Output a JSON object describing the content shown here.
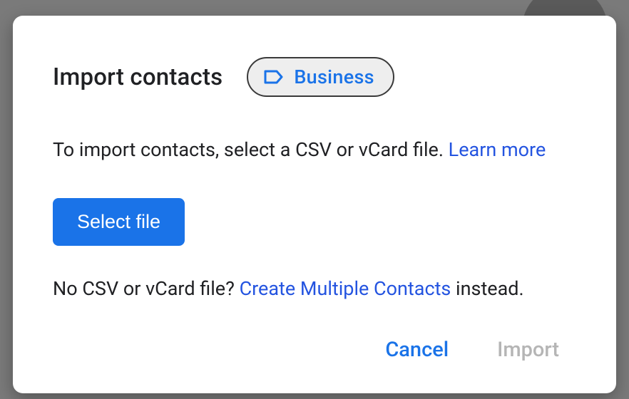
{
  "dialog": {
    "title": "Import contacts",
    "label_chip": "Business",
    "instruction_prefix": "To import contacts, select a CSV or vCard file. ",
    "learn_more": "Learn more",
    "select_file": "Select file",
    "alt_prefix": "No CSV or vCard file? ",
    "create_multiple": "Create Multiple Contacts",
    "alt_suffix": " instead.",
    "cancel": "Cancel",
    "import": "Import"
  }
}
